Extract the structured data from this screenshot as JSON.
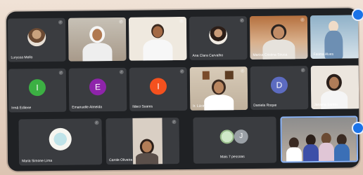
{
  "row1": [
    {
      "name": "Luryssa Mello",
      "kind": "photo"
    },
    {
      "name": "",
      "kind": "video-nun"
    },
    {
      "name": "",
      "kind": "video-woman"
    },
    {
      "name": "Ana Clara Carvalho",
      "kind": "photo"
    },
    {
      "name": "Marisa Cristina Sousa",
      "kind": "video-elder"
    },
    {
      "name": "Fatima Alves",
      "kind": "video-statue"
    }
  ],
  "row2": [
    {
      "name": "Irmã Edilene",
      "initial": "I",
      "color": "#3cb043",
      "kind": "initial"
    },
    {
      "name": "Emanuelle Almeida",
      "initial": "E",
      "color": "#8e24aa",
      "kind": "initial"
    },
    {
      "name": "Ildeci Soares",
      "initial": "I",
      "color": "#f4511e",
      "kind": "initial"
    },
    {
      "name": "Ir. Lúcineia Pereira",
      "kind": "video-room"
    },
    {
      "name": "Daniela Roque",
      "initial": "D",
      "color": "#5c6bc0",
      "kind": "initial"
    },
    {
      "name": "Janaina Santos",
      "kind": "video-woman2"
    }
  ],
  "row3": [
    {
      "name": "Maria Simone Lima",
      "kind": "photo-cartoon"
    },
    {
      "name": "Carole Oliveira",
      "kind": "video-dark"
    },
    {
      "name": "Mais 7 pessoas",
      "initial": "J",
      "kind": "group"
    },
    {
      "name": "",
      "kind": "video-group"
    }
  ]
}
